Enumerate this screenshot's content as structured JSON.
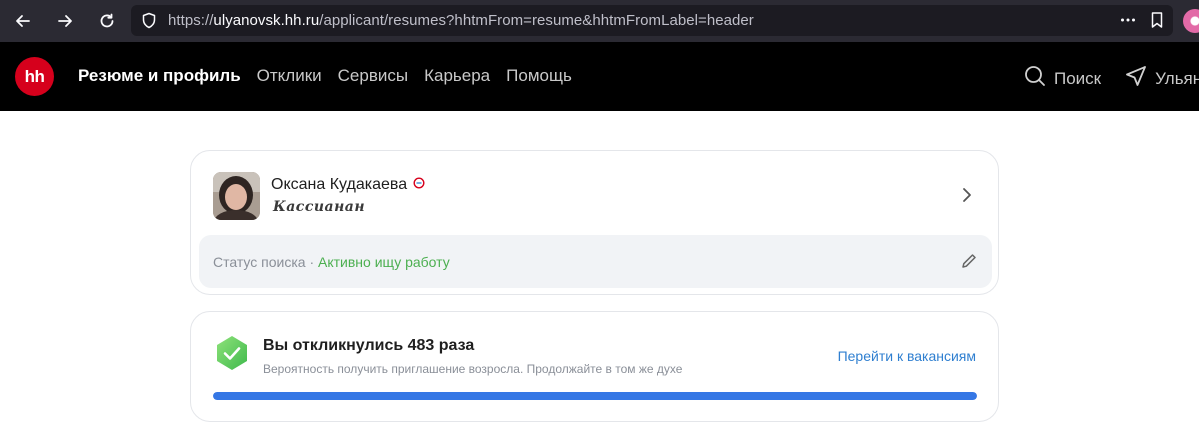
{
  "browser": {
    "url_prefix": "https://",
    "url_host": "ulyanovsk.hh.ru",
    "url_path": "/applicant/resumes?hhtmFrom=resume&hhtmFromLabel=header"
  },
  "header": {
    "logo": "hh",
    "nav": [
      {
        "label": "Резюме и профиль"
      },
      {
        "label": "Отклики"
      },
      {
        "label": "Сервисы"
      },
      {
        "label": "Карьера"
      },
      {
        "label": "Помощь"
      }
    ],
    "search_label": "Поиск",
    "region_label": "Ульян"
  },
  "profile": {
    "name": "Оксана Кудакаева",
    "subtitle": "Кассианан",
    "status_prefix": "Статус поиска · ",
    "status_value": "Активно ищу работу"
  },
  "responses": {
    "title": "Вы откликнулись 483 раза",
    "subtitle": "Вероятность получить приглашение возросла. Продолжайте в том же духе",
    "link": "Перейти к вакансиям",
    "progress": 1.0
  },
  "colors": {
    "brand": "#d6001c",
    "status_ok": "#4caf50",
    "link": "#2f7fd0",
    "progress": "#3577e5"
  }
}
